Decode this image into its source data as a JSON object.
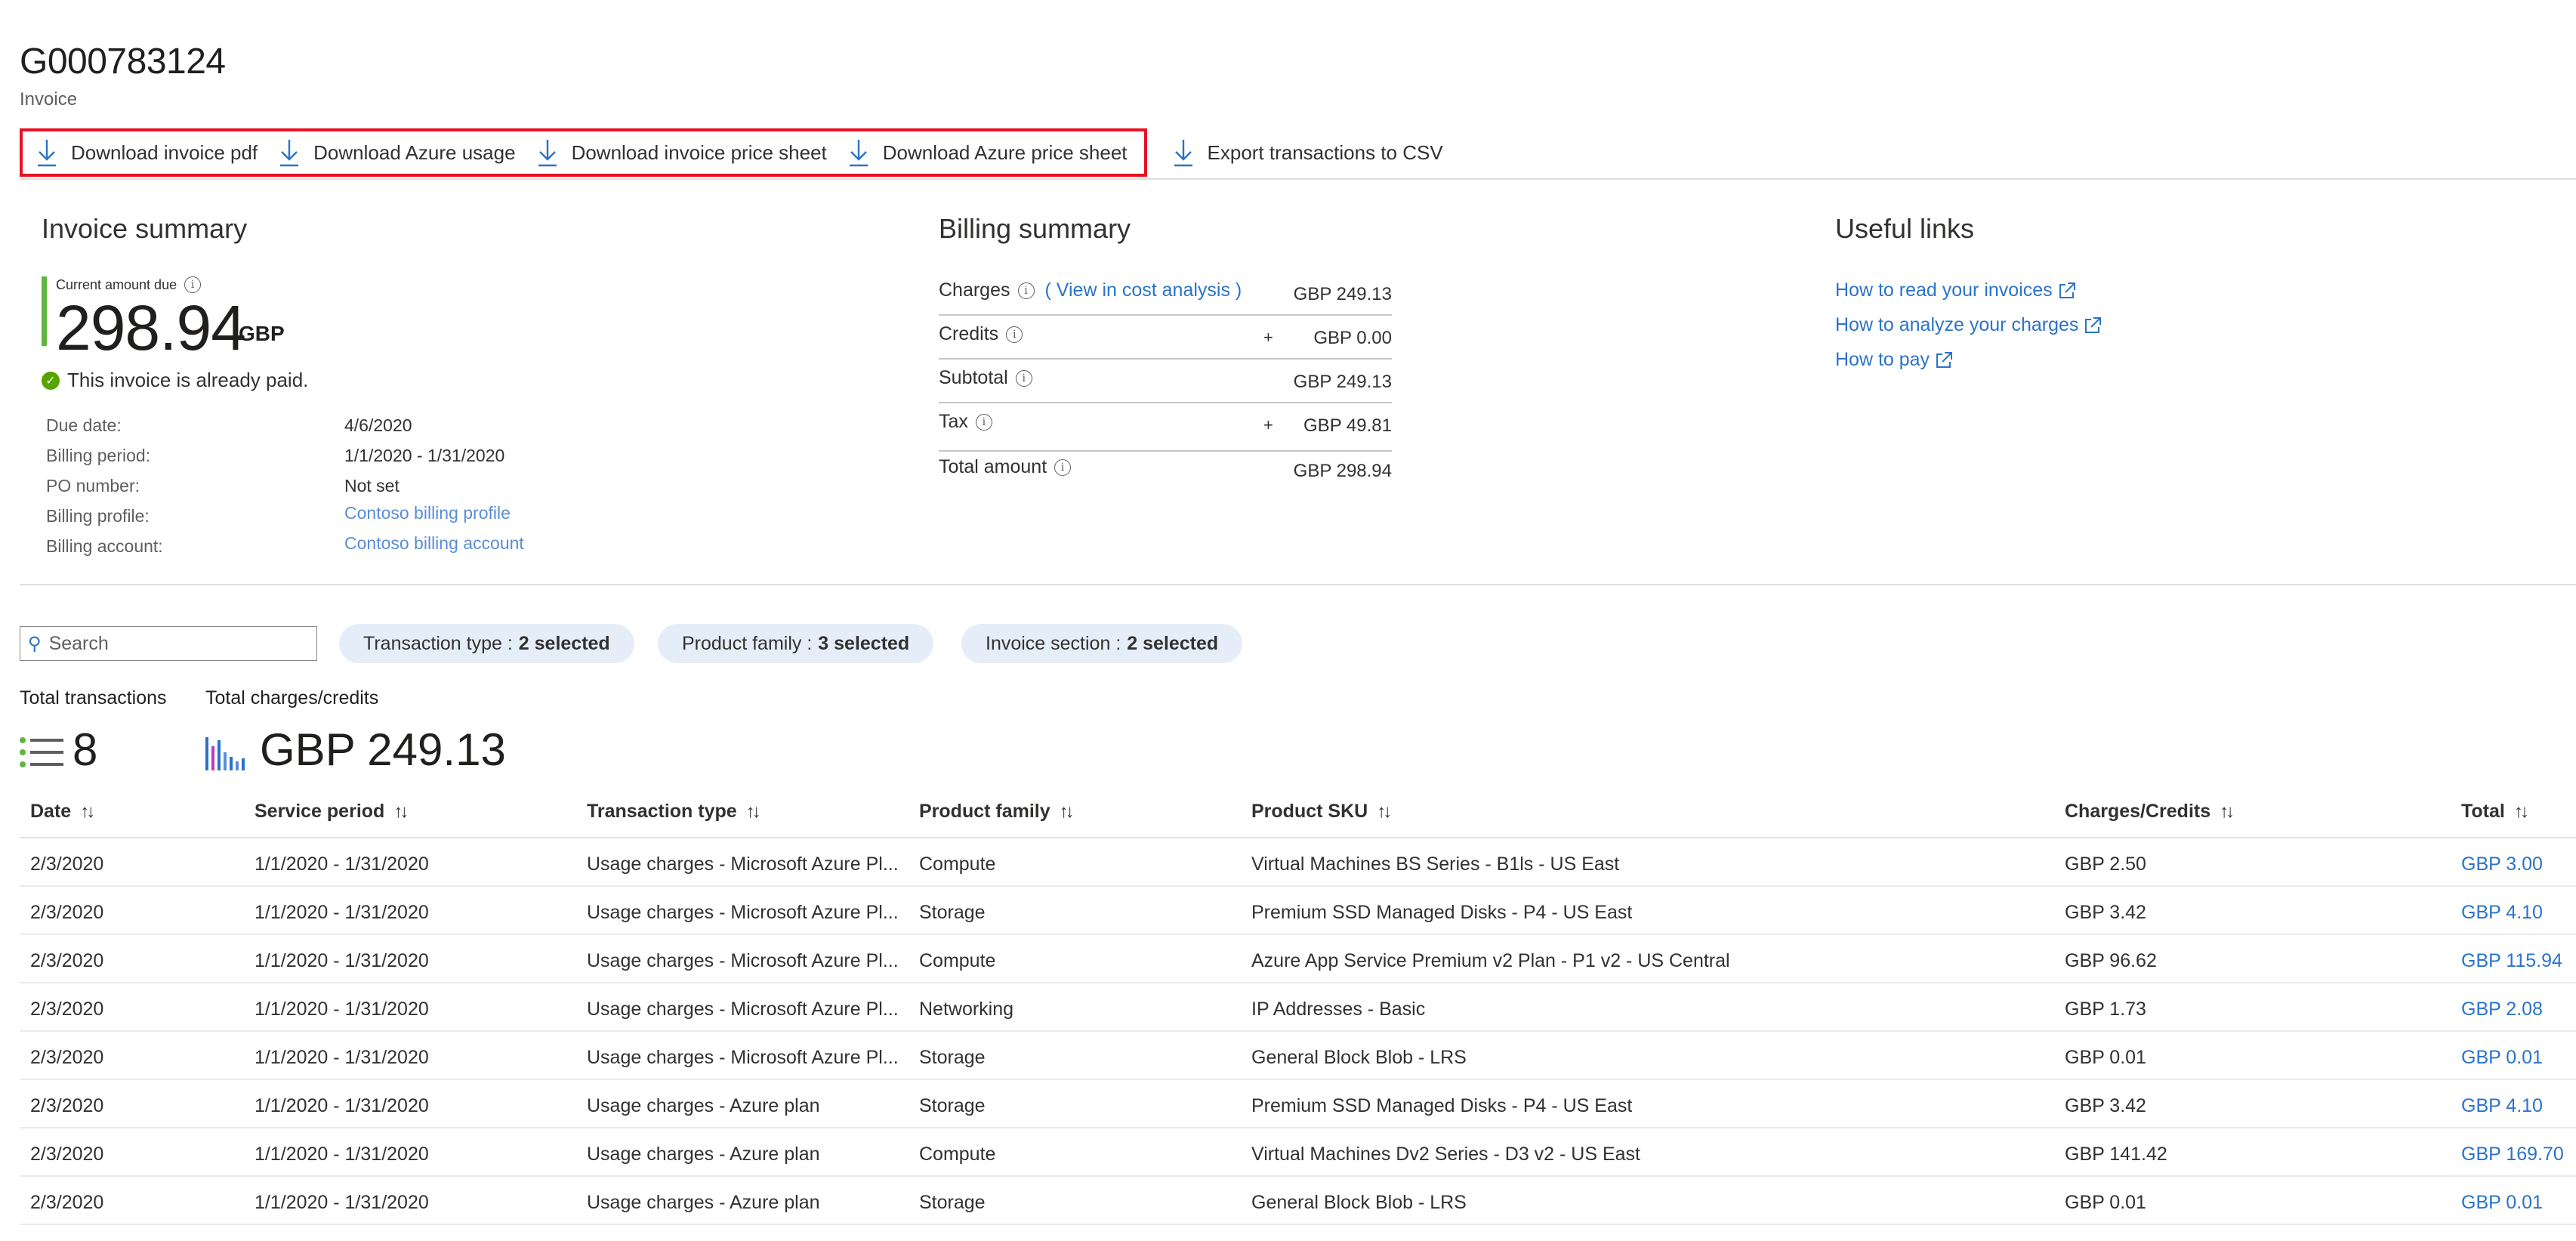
{
  "header": {
    "title": "G000783124",
    "subtitle": "Invoice"
  },
  "toolbar": {
    "download_invoice_pdf": "Download invoice pdf",
    "download_azure_usage": "Download Azure usage",
    "download_invoice_price_sheet": "Download invoice price sheet",
    "download_azure_price_sheet": "Download Azure price sheet",
    "export_csv": "Export transactions to CSV",
    "highlight_color": "#e81123"
  },
  "invoice_summary": {
    "heading": "Invoice summary",
    "current_due_label": "Current amount due",
    "amount": "298.94",
    "currency": "GBP",
    "paid_status": "This invoice is already paid.",
    "details": [
      {
        "label": "Due date:",
        "value": "4/6/2020"
      },
      {
        "label": "Billing period:",
        "value": "1/1/2020 - 1/31/2020"
      },
      {
        "label": "PO number:",
        "value": "Not set"
      },
      {
        "label": "Billing profile:",
        "value": "Contoso billing profile"
      },
      {
        "label": "Billing account:",
        "value": "Contoso billing account"
      }
    ]
  },
  "billing_summary": {
    "heading": "Billing summary",
    "view_link": "( View in cost analysis )",
    "rows": [
      {
        "label": "Charges",
        "sign": "",
        "amount": "GBP 249.13"
      },
      {
        "label": "Credits",
        "sign": "+",
        "amount": "GBP 0.00"
      },
      {
        "label": "Subtotal",
        "sign": "",
        "amount": "GBP 249.13"
      },
      {
        "label": "Tax",
        "sign": "+",
        "amount": "GBP 49.81"
      },
      {
        "label": "Total amount",
        "sign": "",
        "amount": "GBP 298.94"
      }
    ]
  },
  "useful_links": {
    "heading": "Useful links",
    "links": [
      "How to read your invoices",
      "How to analyze your charges",
      "How to pay"
    ]
  },
  "filters": {
    "search_placeholder": "Search",
    "transaction_type": {
      "label": "Transaction type :",
      "value": "2 selected"
    },
    "product_family": {
      "label": "Product family :",
      "value": "3 selected"
    },
    "invoice_section": {
      "label": "Invoice section :",
      "value": "2 selected"
    }
  },
  "stats": {
    "total_transactions_label": "Total transactions",
    "total_transactions": "8",
    "total_charges_label": "Total charges/credits",
    "total_charges": "GBP 249.13"
  },
  "table": {
    "columns": [
      "Date",
      "Service period",
      "Transaction type",
      "Product family",
      "Product SKU",
      "Charges/Credits",
      "Total"
    ],
    "rows": [
      [
        "2/3/2020",
        "1/1/2020 - 1/31/2020",
        "Usage charges - Microsoft Azure Pl...",
        "Compute",
        "Virtual Machines BS Series - B1ls - US East",
        "GBP 2.50",
        "GBP 3.00"
      ],
      [
        "2/3/2020",
        "1/1/2020 - 1/31/2020",
        "Usage charges - Microsoft Azure Pl...",
        "Storage",
        "Premium SSD Managed Disks - P4 - US East",
        "GBP 3.42",
        "GBP 4.10"
      ],
      [
        "2/3/2020",
        "1/1/2020 - 1/31/2020",
        "Usage charges - Microsoft Azure Pl...",
        "Compute",
        "Azure App Service Premium v2 Plan - P1 v2 - US Central",
        "GBP 96.62",
        "GBP 115.94"
      ],
      [
        "2/3/2020",
        "1/1/2020 - 1/31/2020",
        "Usage charges - Microsoft Azure Pl...",
        "Networking",
        "IP Addresses - Basic",
        "GBP 1.73",
        "GBP 2.08"
      ],
      [
        "2/3/2020",
        "1/1/2020 - 1/31/2020",
        "Usage charges - Microsoft Azure Pl...",
        "Storage",
        "General Block Blob - LRS",
        "GBP 0.01",
        "GBP 0.01"
      ],
      [
        "2/3/2020",
        "1/1/2020 - 1/31/2020",
        "Usage charges - Azure plan",
        "Storage",
        "Premium SSD Managed Disks - P4 - US East",
        "GBP 3.42",
        "GBP 4.10"
      ],
      [
        "2/3/2020",
        "1/1/2020 - 1/31/2020",
        "Usage charges - Azure plan",
        "Compute",
        "Virtual Machines Dv2 Series - D3 v2 - US East",
        "GBP 141.42",
        "GBP 169.70"
      ],
      [
        "2/3/2020",
        "1/1/2020 - 1/31/2020",
        "Usage charges - Azure plan",
        "Storage",
        "General Block Blob - LRS",
        "GBP 0.01",
        "GBP 0.01"
      ]
    ]
  }
}
